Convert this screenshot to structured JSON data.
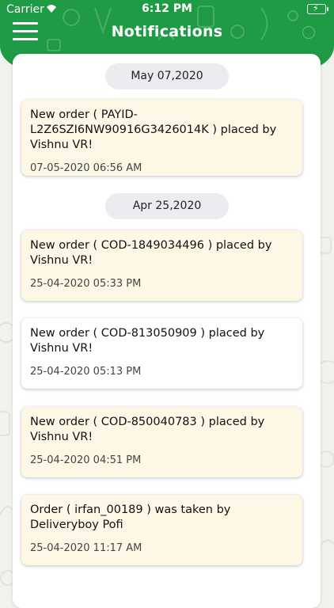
{
  "status_bar": {
    "carrier": "Carrier",
    "time": "6:12 PM"
  },
  "header": {
    "title": "Notifications",
    "menu_icon": "hamburger-menu-icon"
  },
  "colors": {
    "header_green": "#1f9a45",
    "card_unread": "#fdf7e6",
    "card_read": "#ffffff",
    "date_pill": "#ebebf0"
  },
  "groups": [
    {
      "date": "May 07,2020",
      "notifications": [
        {
          "message_lines": [
            "New order ( PAYID-",
            "L2Z6SZI6NW90916G3426014K )  placed by",
            "Vishnu VR!"
          ],
          "timestamp": "07-05-2020 06:56 AM"
        }
      ]
    },
    {
      "date": "Apr 25,2020",
      "notifications": [
        {
          "message_lines": [
            "New order ( COD-1849034496 )  placed by",
            "Vishnu VR!"
          ],
          "timestamp": "25-04-2020 05:33 PM"
        },
        {
          "message_lines": [
            "New order ( COD-813050909 )  placed by",
            "Vishnu VR!"
          ],
          "timestamp": "25-04-2020 05:13 PM"
        },
        {
          "message_lines": [
            "New order ( COD-850040783 )  placed by",
            "Vishnu VR!"
          ],
          "timestamp": "25-04-2020 04:51 PM"
        },
        {
          "message_lines": [
            "Order ( irfan_00189 ) was taken by",
            "Deliveryboy Pofi"
          ],
          "timestamp": "25-04-2020 11:17 AM"
        }
      ]
    }
  ]
}
